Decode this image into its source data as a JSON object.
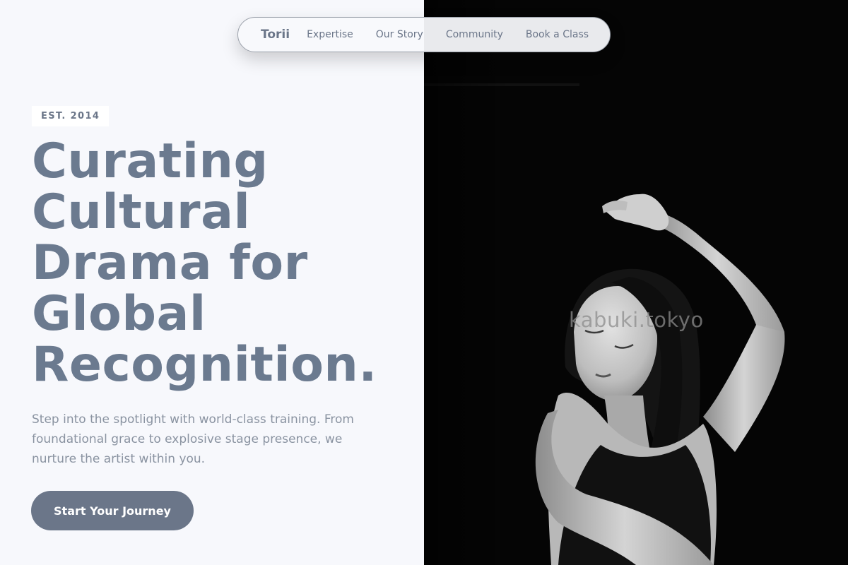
{
  "nav": {
    "brand": "Torii",
    "links": [
      "Expertise",
      "Our Story",
      "Community",
      "Book a Class"
    ]
  },
  "hero": {
    "badge": "EST. 2014",
    "headline_lines": [
      "Curating",
      "Cultural",
      "Drama for",
      "Global",
      "Recognition."
    ],
    "subtext": "Step into the spotlight with world-class training. From foundational grace to explosive stage presence, we nurture the artist within you.",
    "cta_label": "Start Your Journey"
  },
  "photo": {
    "watermark": "kabuki.tokyo",
    "subject": "black-and-white dancer with raised arm"
  },
  "colors": {
    "background": "#f7f8fc",
    "accent": "#6b7689",
    "headline": "#6b7a8f",
    "photo_background": "#050505"
  }
}
